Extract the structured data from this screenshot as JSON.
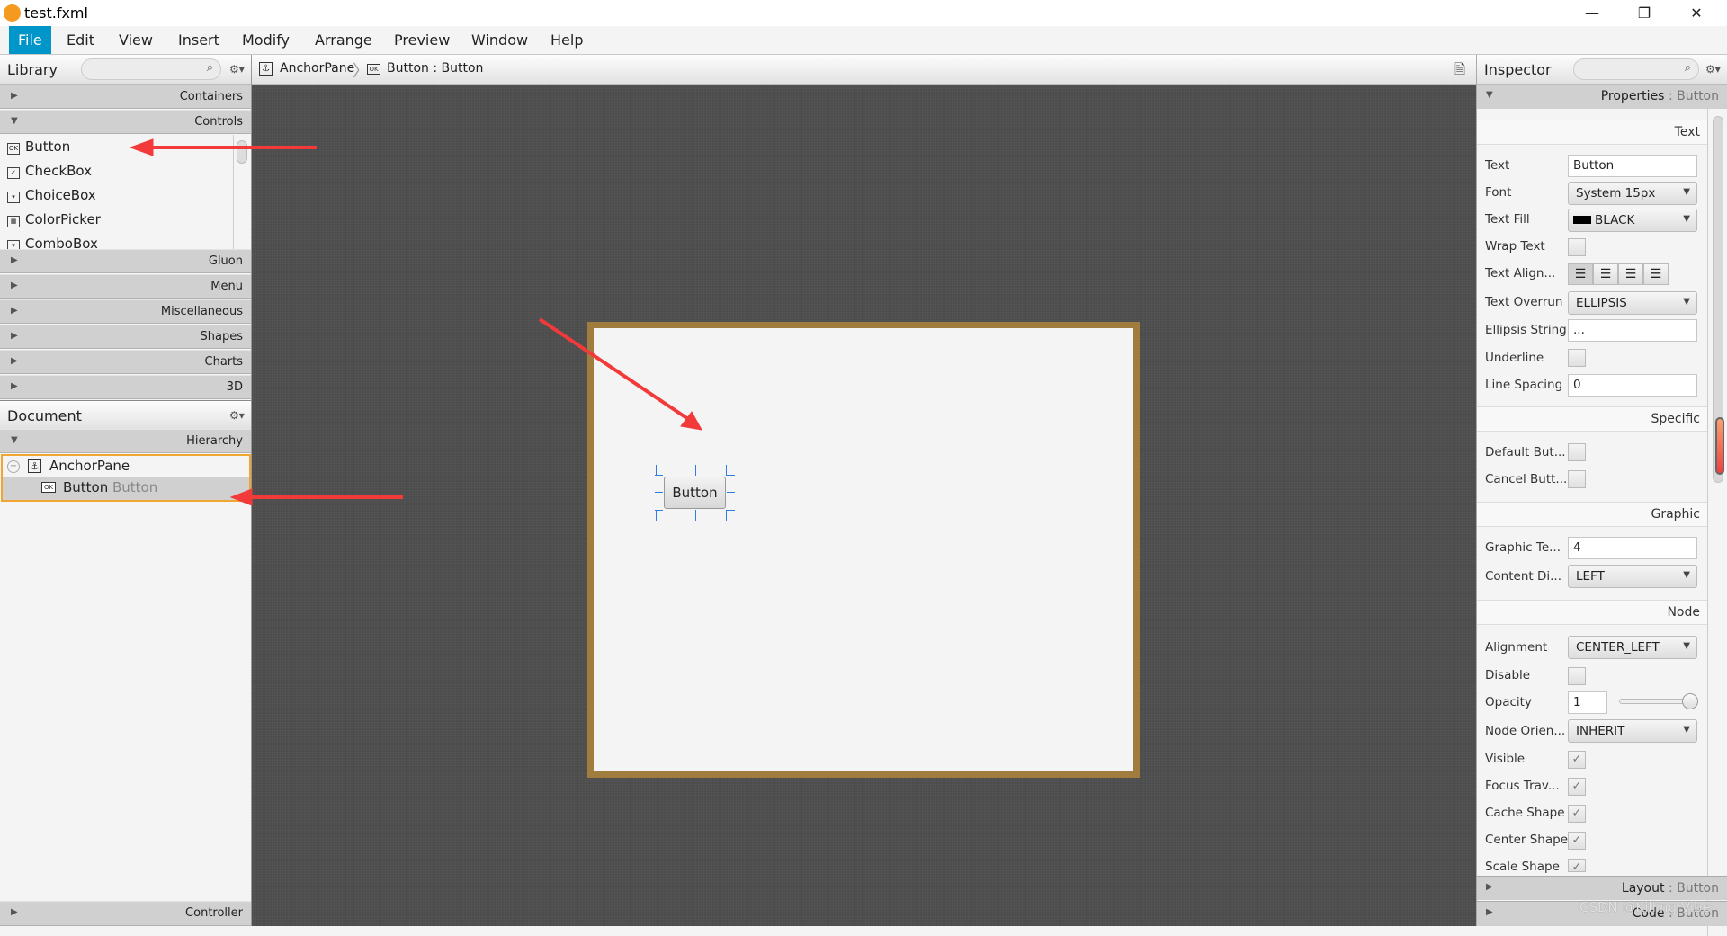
{
  "window": {
    "title": "test.fxml",
    "minimize": "—",
    "restore": "❐",
    "close": "✕"
  },
  "menu": [
    "File",
    "Edit",
    "View",
    "Insert",
    "Modify",
    "Arrange",
    "Preview",
    "Window",
    "Help"
  ],
  "library": {
    "title": "Library",
    "search_icon": "search-icon",
    "sections_top": [
      "Containers",
      "Controls"
    ],
    "items": [
      {
        "label": "Button",
        "icon": "OK"
      },
      {
        "label": "CheckBox",
        "icon": "✓"
      },
      {
        "label": "ChoiceBox",
        "icon": "▾"
      },
      {
        "label": "ColorPicker",
        "icon": "▦"
      },
      {
        "label": "ComboBox",
        "icon": "▾"
      }
    ],
    "sections_bottom": [
      "Gluon",
      "Menu",
      "Miscellaneous",
      "Shapes",
      "Charts",
      "3D"
    ]
  },
  "document": {
    "title": "Document",
    "hierarchy": "Hierarchy",
    "root": "AnchorPane",
    "child": "Button",
    "child_type": "Button",
    "controller": "Controller"
  },
  "breadcrumb": {
    "root": "AnchorPane",
    "selected": "Button : Button"
  },
  "canvas": {
    "button_label": "Button",
    "frame_color": "#a07c3e",
    "selection_color": "#2f7de1"
  },
  "inspector": {
    "title": "Inspector",
    "properties_label": "Properties",
    "properties_target": ": Button",
    "groups": {
      "text": "Text",
      "specific": "Specific",
      "graphic": "Graphic",
      "node": "Node"
    },
    "props": {
      "text": {
        "label": "Text",
        "value": "Button"
      },
      "font": {
        "label": "Font",
        "value": "System 15px"
      },
      "text_fill": {
        "label": "Text Fill",
        "value": "BLACK",
        "swatch": "#000000"
      },
      "wrap_text": {
        "label": "Wrap Text",
        "checked": false
      },
      "text_align": {
        "label": "Text Align...",
        "selected": "left"
      },
      "text_overrun": {
        "label": "Text Overrun",
        "value": "ELLIPSIS"
      },
      "ellipsis_string": {
        "label": "Ellipsis String",
        "value": "..."
      },
      "underline": {
        "label": "Underline",
        "checked": false
      },
      "line_spacing": {
        "label": "Line Spacing",
        "value": "0"
      },
      "default_button": {
        "label": "Default But...",
        "checked": false
      },
      "cancel_button": {
        "label": "Cancel Butt...",
        "checked": false
      },
      "graphic_text_gap": {
        "label": "Graphic Te...",
        "value": "4"
      },
      "content_display": {
        "label": "Content Di...",
        "value": "LEFT"
      },
      "alignment": {
        "label": "Alignment",
        "value": "CENTER_LEFT"
      },
      "disable": {
        "label": "Disable",
        "checked": false
      },
      "opacity": {
        "label": "Opacity",
        "value": "1",
        "slider": 1
      },
      "node_orientation": {
        "label": "Node Orien...",
        "value": "INHERIT"
      },
      "visible": {
        "label": "Visible",
        "checked": true
      },
      "focus_traversable": {
        "label": "Focus Trav...",
        "checked": true
      },
      "cache_shape": {
        "label": "Cache Shape",
        "checked": true
      },
      "center_shape": {
        "label": "Center Shape",
        "checked": true
      },
      "scale_shape": {
        "label": "Scale Shape",
        "checked": true
      }
    },
    "layout_label": "Layout",
    "code_label": "Code",
    "target": ": Button"
  },
  "watermark": "CSDN @Killing Vibe",
  "check_mark": "✓"
}
